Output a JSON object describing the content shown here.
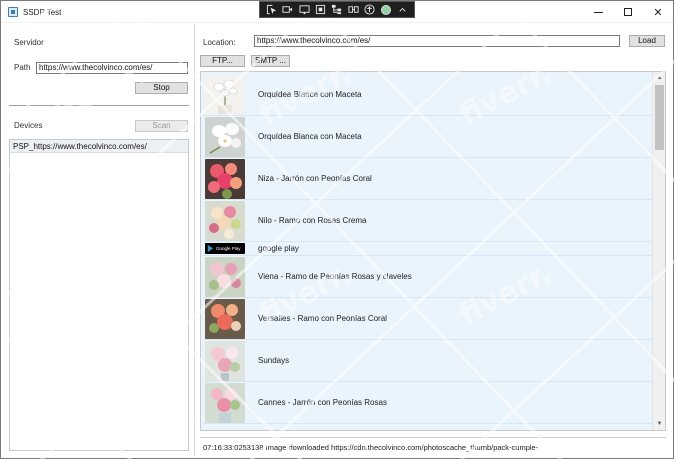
{
  "window": {
    "title": "SSDP Test"
  },
  "left": {
    "servidor_label": "Servidor",
    "path_label": "Path",
    "path_value": "https://www.thecolvinco.com/es/",
    "stop_label": "Stop",
    "devices_label": "Devices",
    "scan_label": "Scan",
    "devices": [
      "PSP_https://www.thecolvinco.com/es/"
    ]
  },
  "right": {
    "location_label": "Location:",
    "location_value": "https://www.thecolvinco.com/es/",
    "load_label": "Load",
    "ftp_label": "FTP...",
    "smtp_label": "SMTP ..."
  },
  "products": [
    {
      "name": "Orquídea Blanca con Maceta",
      "thumb": "orchid-pot"
    },
    {
      "name": "Orquídea Blanca con Maceta",
      "thumb": "orchid"
    },
    {
      "name": "Niza - Jarrón con Peonías Coral",
      "thumb": "coral-peony-vase"
    },
    {
      "name": "Nilo - Ramo con Rosas Crema",
      "thumb": "cream-rose-bouquet"
    },
    {
      "name": "google play",
      "thumb": "google-play-badge",
      "badge_text": "Google Play"
    },
    {
      "name": "Viena - Ramo de Peonías Rosas y claveles",
      "thumb": "pink-peony-bouquet"
    },
    {
      "name": "Versalles - Ramo con Peonías Coral",
      "thumb": "coral-peony-bouquet"
    },
    {
      "name": "Sundays",
      "thumb": "pink-bouquet"
    },
    {
      "name": "Cannes - Jarrón con Peonías Rosas",
      "thumb": "rose-vase"
    }
  ],
  "status": {
    "text": "07:16:33:0253138 Image downloaded https://cdn.thecolvinco.com/photoscache_thumb/pack-cumple-"
  },
  "watermark_text": "fiverr.",
  "colors": {
    "list_bg": "#eaf4fd",
    "titlebar_toolbar": "#1f1f1f"
  }
}
